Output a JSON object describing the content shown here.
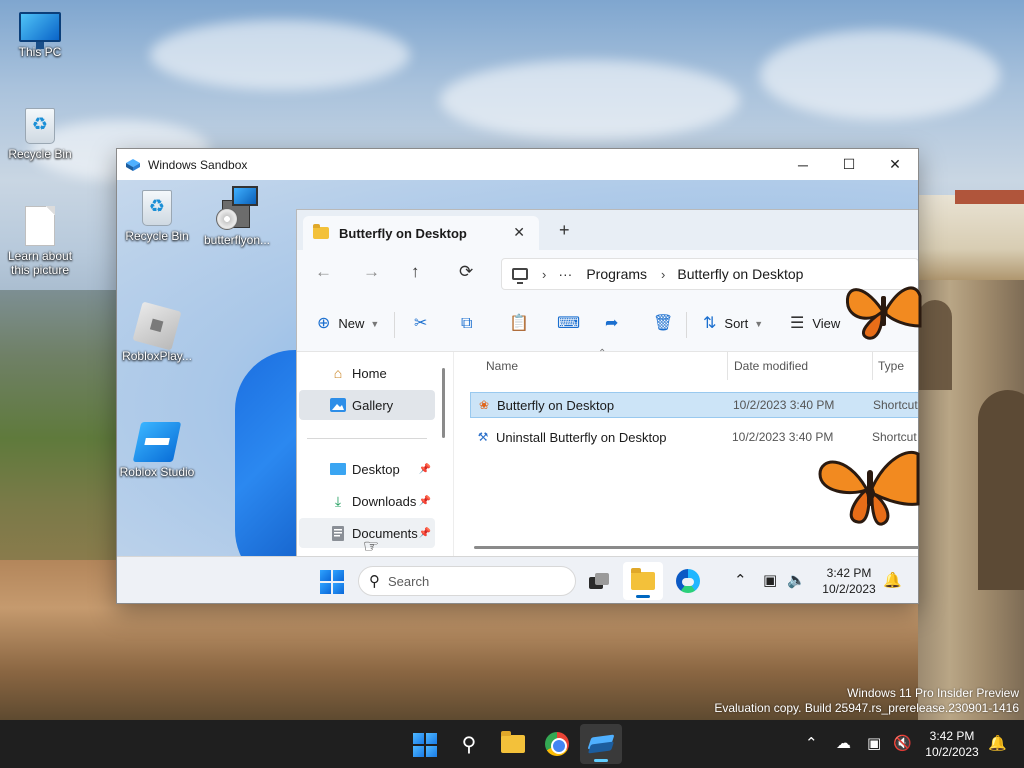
{
  "desktop": {
    "icons": [
      {
        "label": "This PC",
        "icon": "monitor-icon"
      },
      {
        "label": "Recycle Bin",
        "icon": "recycle-bin-icon"
      },
      {
        "label": "Learn about this picture",
        "icon": "document-icon"
      }
    ],
    "watermark": {
      "line1": "Windows 11 Pro Insider Preview",
      "line2": "Evaluation copy. Build 25947.rs_prerelease.230901-1416"
    }
  },
  "sandbox": {
    "title": "Windows Sandbox",
    "controls": {
      "minimize": "─",
      "maximize": "☐",
      "close": "✕"
    },
    "desktop_icons": [
      {
        "label": "Recycle Bin"
      },
      {
        "label": "butterflyon..."
      },
      {
        "label": "RobloxPlay..."
      },
      {
        "label": "Roblox Studio"
      }
    ],
    "taskbar": {
      "search_placeholder": "Search",
      "time": "3:42 PM",
      "date": "10/2/2023"
    }
  },
  "explorer": {
    "tab_title": "Butterfly on Desktop",
    "new_tab": "+",
    "close_tab": "✕",
    "breadcrumb": {
      "more": "···",
      "items": [
        "Programs",
        "Butterfly on Desktop"
      ]
    },
    "commands": {
      "new": "New",
      "sort": "Sort",
      "view": "View"
    },
    "nav": {
      "home": "Home",
      "gallery": "Gallery",
      "desktop": "Desktop",
      "downloads": "Downloads",
      "documents": "Documents"
    },
    "columns": {
      "name": "Name",
      "date": "Date modified",
      "type": "Type"
    },
    "files": [
      {
        "name": "Butterfly on Desktop",
        "date": "10/2/2023 3:40 PM",
        "type": "Shortcut"
      },
      {
        "name": "Uninstall Butterfly on Desktop",
        "date": "10/2/2023 3:40 PM",
        "type": "Shortcut"
      }
    ]
  },
  "host_taskbar": {
    "time": "3:42 PM",
    "date": "10/2/2023"
  }
}
